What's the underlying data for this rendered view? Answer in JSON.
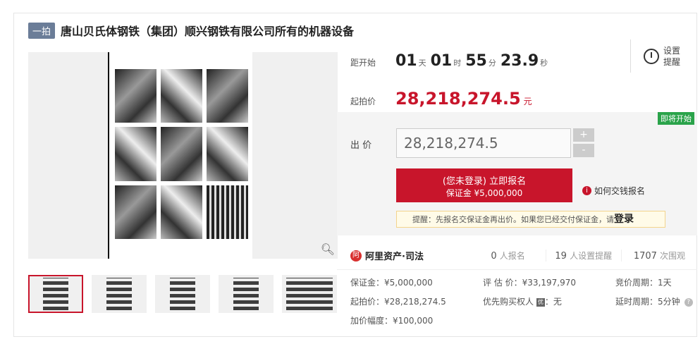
{
  "header": {
    "tag": "一拍",
    "title": "唐山贝氏体钢铁（集团）顺兴钢铁有限公司所有的机器设备"
  },
  "countdown": {
    "label": "距开始",
    "days": "01",
    "days_unit": "天",
    "hours": "01",
    "hours_unit": "时",
    "minutes": "55",
    "minutes_unit": "分",
    "seconds": "23.9",
    "seconds_unit": "秒"
  },
  "remind": {
    "line1": "设置",
    "line2": "提醒"
  },
  "start_price": {
    "label": "起拍价",
    "value": "28,218,274.5",
    "unit": "元"
  },
  "status_badge": "即将开始",
  "bid": {
    "label": "出 价",
    "input_value": "28,218,274.5",
    "plus": "+",
    "minus": "-"
  },
  "register_button": {
    "line1": "(您未登录) 立即报名",
    "line2": "保证金 ¥5,000,000"
  },
  "howto_link": "如何交钱报名",
  "tip": {
    "text": "提醒：先报名交保证金再出价。如果您已经交付保证金，请",
    "link": "登录"
  },
  "brand": {
    "name": "阿里资产·司法",
    "logo": "阿"
  },
  "stats": [
    {
      "value": "0",
      "label": "人报名"
    },
    {
      "value": "19",
      "label": "人设置提醒"
    },
    {
      "value": "1707",
      "label": "次围观"
    }
  ],
  "details": {
    "deposit": "保证金：¥5,000,000",
    "appraisal": "评 估 价：¥33,197,970",
    "cycle": "竞价周期：1天",
    "start": "起拍价：¥28,218,274.5",
    "priority": "优先购买权人",
    "priority_badge": "优",
    "priority_value": "：无",
    "delay": "延时周期：5分钟",
    "increment": "加价幅度：¥100,000"
  },
  "colors": {
    "accent": "#c8152b",
    "status": "#2aa34a",
    "tag": "#6b7d98"
  }
}
